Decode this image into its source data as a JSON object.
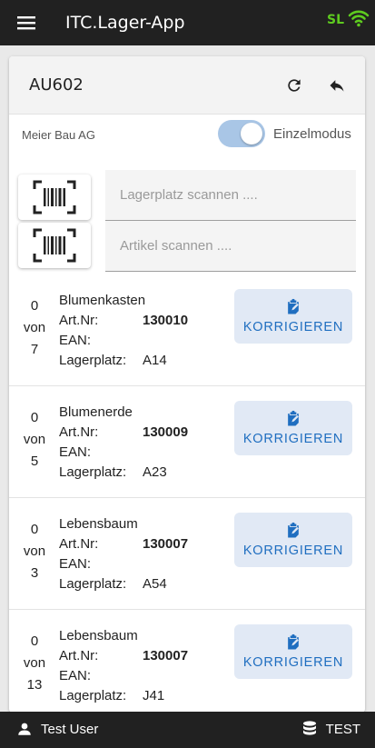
{
  "app": {
    "title": "ITC.Lager-App",
    "status_text": "SL",
    "status_color": "#5ecb1f"
  },
  "order": {
    "id": "AU602",
    "customer": "Meier Bau AG",
    "mode_label": "Einzelmodus",
    "mode_on": true
  },
  "scan": {
    "location_placeholder": "Lagerplatz scannen ....",
    "article_placeholder": "Artikel scannen ...."
  },
  "labels": {
    "artnr": "Art.Nr:",
    "ean": "EAN:",
    "lagerplatz": "Lagerplatz:",
    "von": "von",
    "korrigieren": "KORRIGIEREN"
  },
  "items": [
    {
      "done": "0",
      "total": "7",
      "name": "Blumenkasten",
      "artnr": "130010",
      "ean": "",
      "lagerplatz": "A14"
    },
    {
      "done": "0",
      "total": "5",
      "name": "Blumenerde",
      "artnr": "130009",
      "ean": "",
      "lagerplatz": "A23"
    },
    {
      "done": "0",
      "total": "3",
      "name": "Lebensbaum",
      "artnr": "130007",
      "ean": "",
      "lagerplatz": "A54"
    },
    {
      "done": "0",
      "total": "13",
      "name": "Lebensbaum",
      "artnr": "130007",
      "ean": "",
      "lagerplatz": "J41"
    }
  ],
  "footer": {
    "user": "Test User",
    "database": "TEST"
  },
  "colors": {
    "appbar": "#212121",
    "accent": "#1f6ec0",
    "button_bg": "#e1e9f5",
    "toggle": "#a9c6e6"
  }
}
